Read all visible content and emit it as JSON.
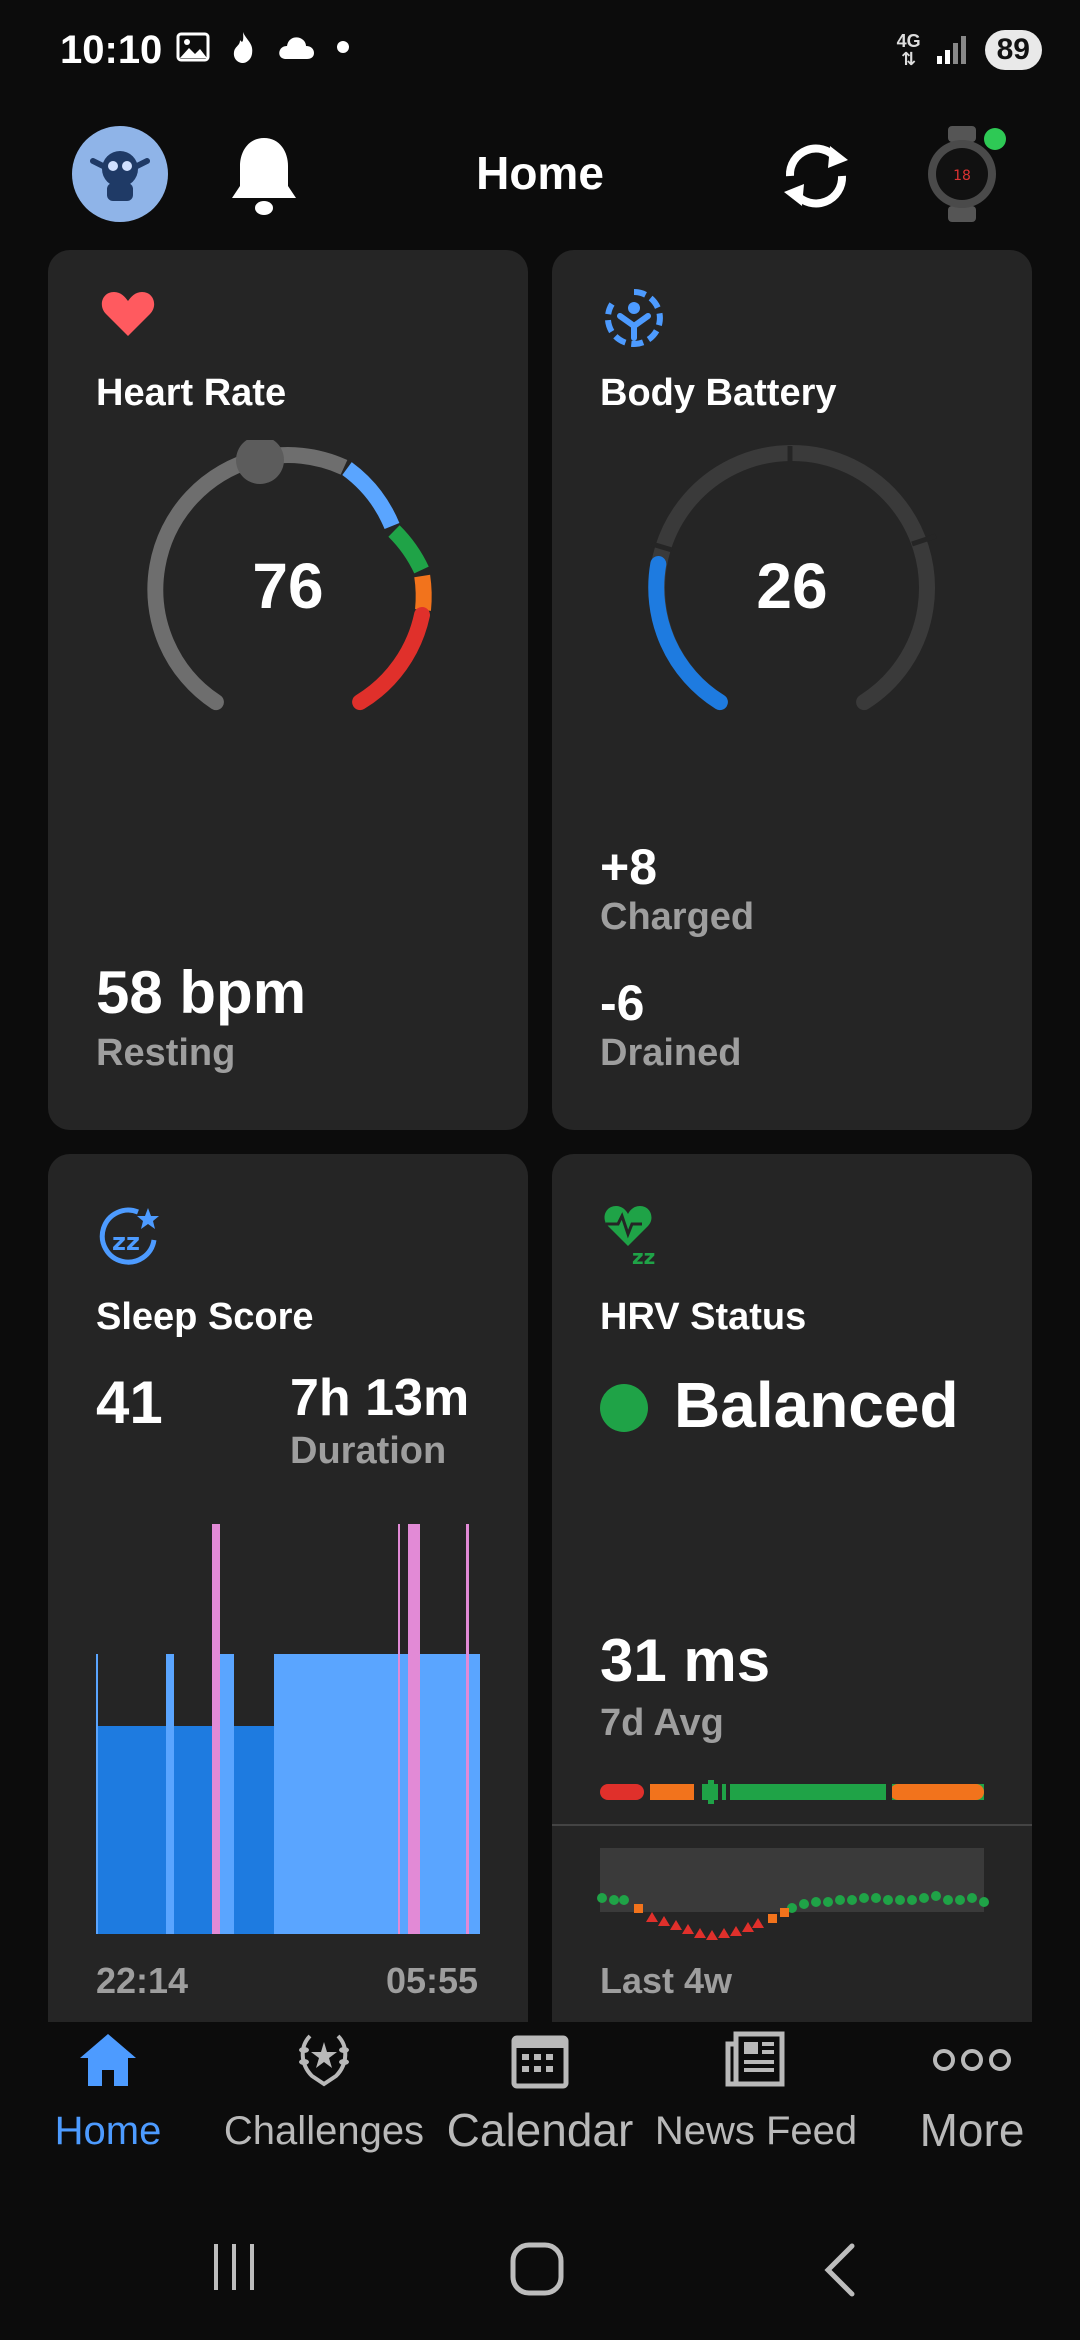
{
  "status_bar": {
    "time": "10:10",
    "network": "4G",
    "battery": "89"
  },
  "header": {
    "title": "Home"
  },
  "cards": {
    "heart_rate": {
      "title": "Heart Rate",
      "value": "76",
      "resting_value": "58 bpm",
      "resting_label": "Resting"
    },
    "body_battery": {
      "title": "Body Battery",
      "value": "26",
      "charged_value": "+8",
      "charged_label": "Charged",
      "drained_value": "-6",
      "drained_label": "Drained"
    },
    "sleep_score": {
      "title": "Sleep Score",
      "score": "41",
      "duration_value": "7h 13m",
      "duration_label": "Duration",
      "start_time": "22:14",
      "end_time": "05:55"
    },
    "hrv_status": {
      "title": "HRV Status",
      "status": "Balanced",
      "avg_value": "31 ms",
      "avg_label": "7d Avg",
      "period_label": "Last 4w"
    }
  },
  "bottom_nav": {
    "items": [
      {
        "label": "Home",
        "icon": "home-icon",
        "active": true
      },
      {
        "label": "Challenges",
        "icon": "laurel-icon",
        "active": false
      },
      {
        "label": "Calendar",
        "icon": "calendar-icon",
        "active": false
      },
      {
        "label": "News Feed",
        "icon": "news-feed-icon",
        "active": false
      },
      {
        "label": "More",
        "icon": "more-dots-icon",
        "active": false
      }
    ]
  },
  "colors": {
    "accent": "#4d9bff",
    "card_bg": "#252525",
    "heart": "#ff5a5f",
    "hrv_green": "#1fa347",
    "body_battery_blue": "#1e7be0"
  }
}
